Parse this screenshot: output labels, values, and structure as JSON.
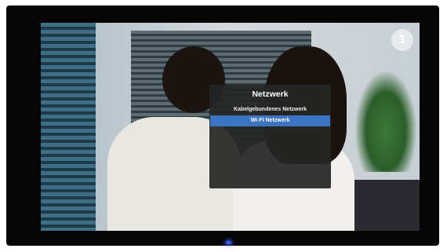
{
  "channel_logo": {
    "text": "1",
    "icon": "channel-logo-icon"
  },
  "osd": {
    "title": "Netzwerk",
    "items": [
      {
        "label": "Kabelgebundenes Netzwerk",
        "selected": false
      },
      {
        "label": "Wi-Fi Netzwerk",
        "selected": true
      }
    ]
  },
  "colors": {
    "menu_background": "#262626",
    "selection_highlight": "#3a74c2",
    "power_led": "#3a5cff"
  }
}
